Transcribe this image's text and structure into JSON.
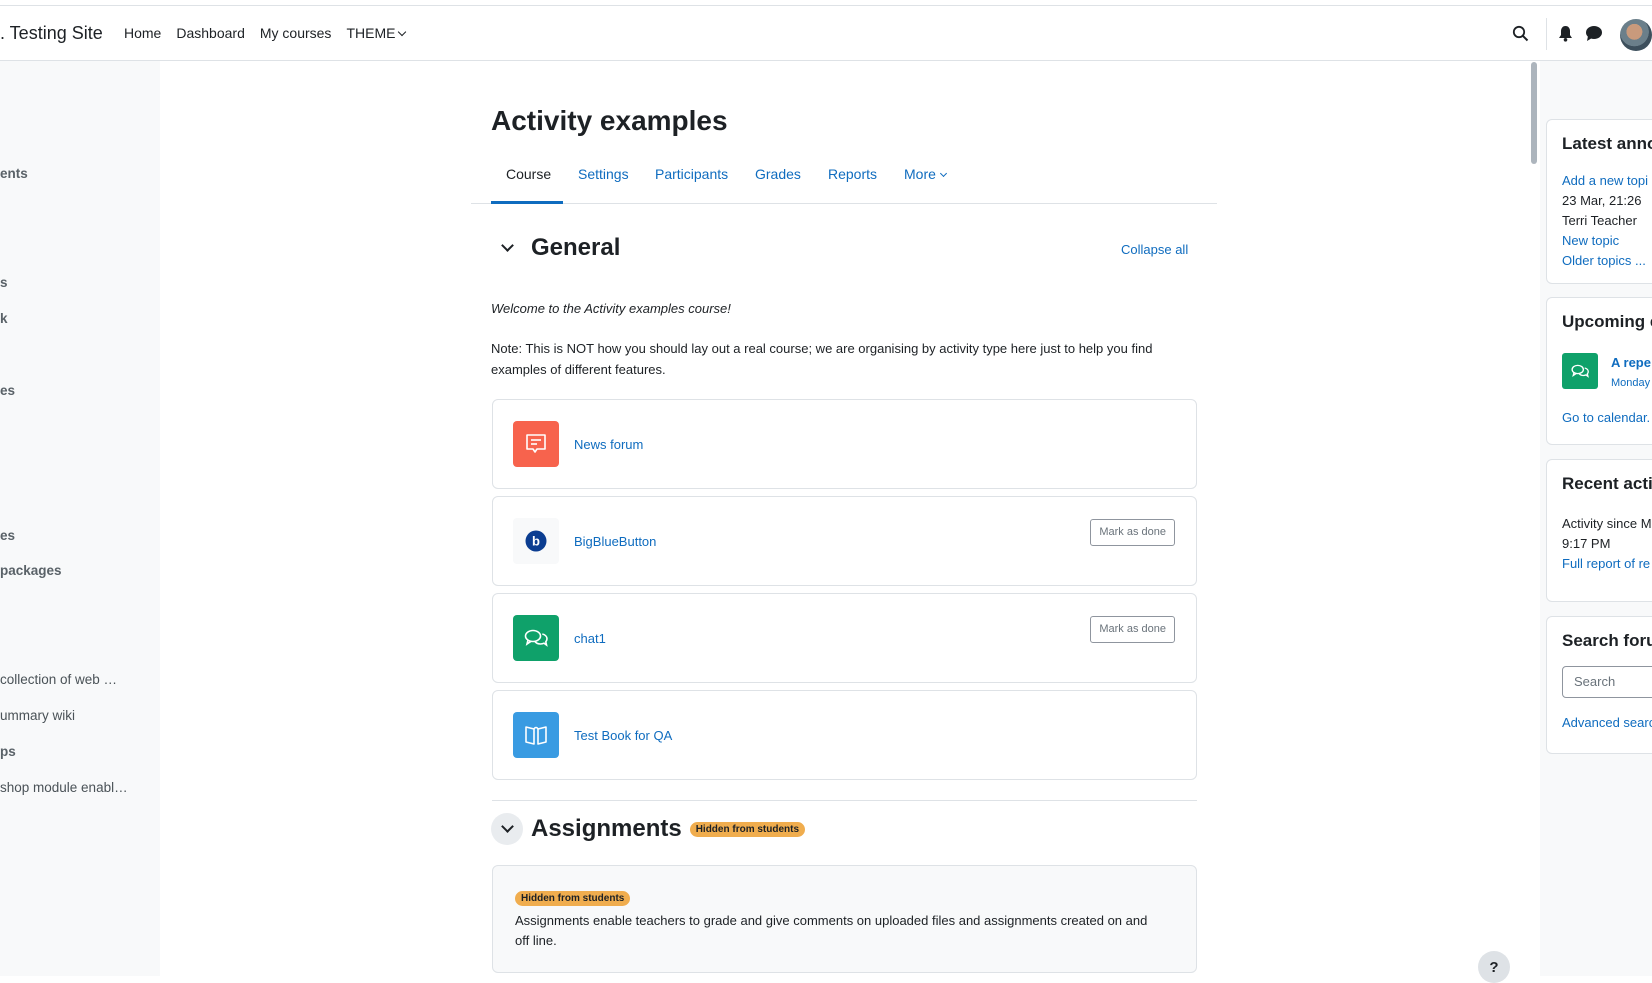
{
  "site": {
    "name": ". Testing Site"
  },
  "topnav": {
    "home": "Home",
    "dashboard": "Dashboard",
    "my_courses": "My courses",
    "theme": "THEME"
  },
  "icons": {
    "search": "search-icon",
    "notifications": "bell-icon",
    "messages": "chat-bubble-icon",
    "user": "avatar"
  },
  "drawer": {
    "items": [
      {
        "label": "ents",
        "style": "bold"
      },
      {
        "label": "s",
        "style": "bold"
      },
      {
        "label": "k",
        "style": "bold"
      },
      {
        "label": "es",
        "style": "bold"
      },
      {
        "label": "es",
        "style": "bold"
      },
      {
        "label": "packages",
        "style": "bold"
      },
      {
        "label": "collection of web …",
        "style": "reg"
      },
      {
        "label": "ummary wiki",
        "style": "reg"
      },
      {
        "label": "ps",
        "style": "bold"
      },
      {
        "label": "shop module enabl…",
        "style": "reg"
      }
    ]
  },
  "course": {
    "title": "Activity examples",
    "tabs": {
      "course": "Course",
      "settings": "Settings",
      "participants": "Participants",
      "grades": "Grades",
      "reports": "Reports",
      "more": "More"
    },
    "collapse_all": "Collapse all",
    "sections": {
      "general": {
        "title": "General"
      },
      "assignments": {
        "title": "Assignments",
        "badge": "Hidden from students",
        "summary_badge": "Hidden from students",
        "summary": "Assignments enable teachers to grade and give comments on uploaded files and assignments created on and off line."
      }
    },
    "welcome": "Welcome to the Activity examples course!",
    "note": "Note: This is NOT how you should lay out a real course; we are organising by activity type here just to help you find examples of different features.",
    "activities": [
      {
        "name": "News forum",
        "icon": "forum-icon",
        "color": "#f7634d"
      },
      {
        "name": "BigBlueButton",
        "icon": "bigbluebutton-icon",
        "color": "#f8f9fa",
        "mark": "Mark as done"
      },
      {
        "name": "chat1",
        "icon": "chat-icon",
        "color": "#0fa16a",
        "mark": "Mark as done"
      },
      {
        "name": "Test Book for QA",
        "icon": "book-icon",
        "color": "#399be2"
      }
    ]
  },
  "help": {
    "label": "?"
  },
  "blocks": {
    "announcements": {
      "title": "Latest anno",
      "add": "Add a new topi",
      "date": "23 Mar, 21:26",
      "author": "Terri Teacher",
      "topic": "New topic",
      "older": "Older topics ..."
    },
    "upcoming": {
      "title": "Upcoming e",
      "event_name": "A repe",
      "event_date": "Monday",
      "calendar": "Go to calendar."
    },
    "recent": {
      "title": "Recent acti",
      "since": "Activity since M",
      "time": "9:17 PM",
      "full": "Full report of re"
    },
    "search": {
      "title": "Search foru",
      "placeholder": "Search",
      "advanced": "Advanced searc"
    }
  },
  "colors": {
    "link": "#0f6cbf",
    "badge": "#f0ad4e",
    "forum": "#f7634d",
    "chat": "#0fa16a",
    "book": "#399be2"
  }
}
